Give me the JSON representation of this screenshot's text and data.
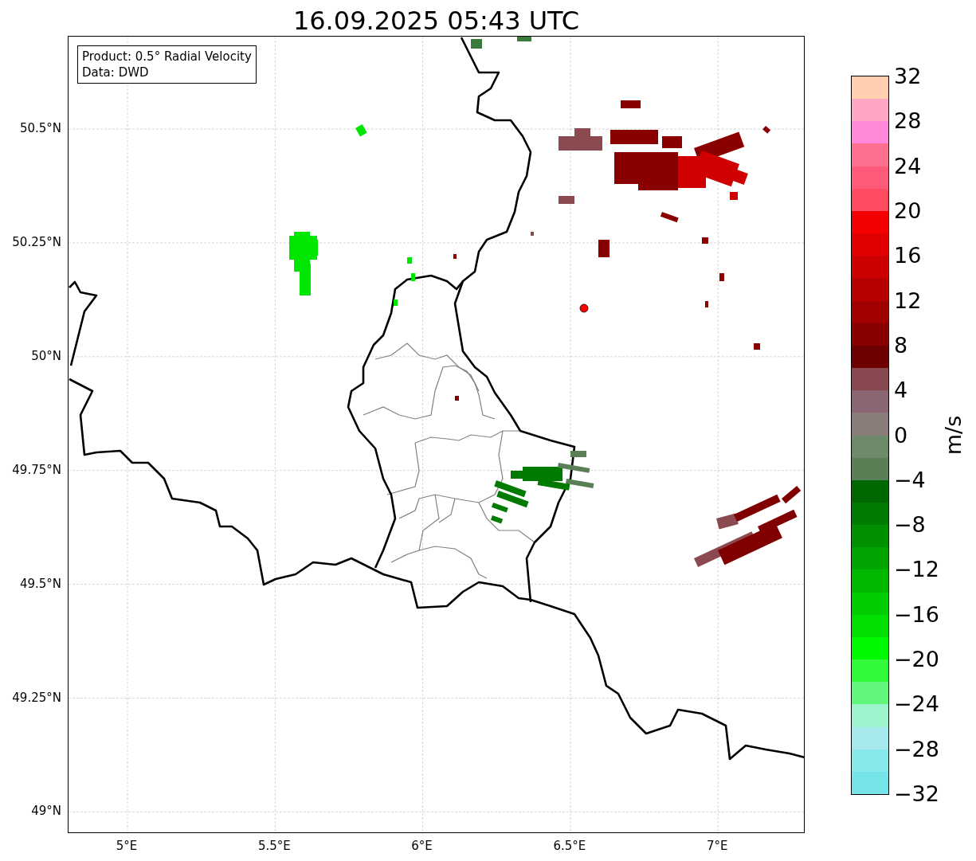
{
  "title": "16.09.2025 05:43 UTC",
  "info_box": {
    "lines": [
      "Product: 0.5° Radial Velocity",
      "Data: DWD"
    ]
  },
  "y_ticks": [
    "50.5°N",
    "50.25°N",
    "50°N",
    "49.75°N",
    "49.5°N",
    "49.25°N",
    "49°N"
  ],
  "x_ticks": [
    "5°E",
    "5.5°E",
    "6°E",
    "6.5°E",
    "7°E"
  ],
  "colorbar": {
    "label": "m/s",
    "ticks": [
      "32",
      "28",
      "24",
      "20",
      "16",
      "12",
      "8",
      "4",
      "0",
      "−4",
      "−8",
      "−12",
      "−16",
      "−20",
      "−24",
      "−28",
      "−32"
    ],
    "bins": [
      {
        "color": "#ffcfb0"
      },
      {
        "color": "#ffa6c4"
      },
      {
        "color": "#ff88d8"
      },
      {
        "color": "#ff7090"
      },
      {
        "color": "#ff5a7a"
      },
      {
        "color": "#ff4a60"
      },
      {
        "color": "#f40000"
      },
      {
        "color": "#e00000"
      },
      {
        "color": "#cc0000"
      },
      {
        "color": "#b80000"
      },
      {
        "color": "#a00000"
      },
      {
        "color": "#880000"
      },
      {
        "color": "#6e0000"
      },
      {
        "color": "#874850"
      },
      {
        "color": "#8a6672"
      },
      {
        "color": "#8a7c78"
      },
      {
        "color": "#6e8a6a"
      },
      {
        "color": "#5a7e56"
      },
      {
        "color": "#006800"
      },
      {
        "color": "#007c00"
      },
      {
        "color": "#009000"
      },
      {
        "color": "#00a400"
      },
      {
        "color": "#00b800"
      },
      {
        "color": "#00cc00"
      },
      {
        "color": "#00e000"
      },
      {
        "color": "#00f800"
      },
      {
        "color": "#30fa3a"
      },
      {
        "color": "#62f67c"
      },
      {
        "color": "#9cf4cc"
      },
      {
        "color": "#a6eaee"
      },
      {
        "color": "#88e8ec"
      },
      {
        "color": "#74e4e8"
      }
    ]
  }
}
